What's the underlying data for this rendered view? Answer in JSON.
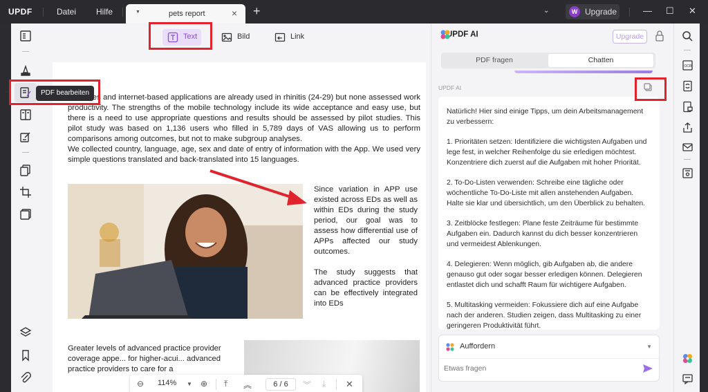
{
  "app": {
    "logo": "UPDF"
  },
  "menu": {
    "file": "Datei",
    "help": "Hilfe"
  },
  "tab": {
    "title": "pets report",
    "close": "×",
    "add": "+"
  },
  "account": {
    "avatar_letter": "W",
    "upgrade": "Upgrade"
  },
  "window_controls": {
    "minimize": "—",
    "maximize": "☐",
    "close": "✕"
  },
  "edit_toolbar": {
    "text": "Text",
    "image": "Bild",
    "link": "Link"
  },
  "tooltip": {
    "label": "PDF bearbeiten"
  },
  "document": {
    "para1": "...devices and internet-based applications are already used in rhinitis (24-29) but none assessed work productivity. The strengths of the mobile technology include its wide acceptance and easy use, but there is a need to use appropriate questions and results should be assessed by pilot studies. This pilot study was based on 1,136 users who filled in 5,789 days of VAS allowing us to perform comparisons among outcomes, but not to make subgroup analyses.",
    "para2": "We collected country, language, age, sex and date of entry of information with the App. We used very simple questions translated and back-translated into 15 languages.",
    "para3": "Since variation in APP use existed across EDs as well as within EDs during the study period, our goal was to assess how differential use of APPs affected our study outcomes.",
    "para4": "The study suggests that advanced practice providers can be effectively integrated into EDs",
    "para5": "Greater levels of advanced practice provider coverage appe... for higher-acui... advanced practice providers to care for a"
  },
  "page_nav": {
    "zoom": "114%",
    "current_page": "6",
    "total_pages": "6"
  },
  "ai": {
    "title": "UPDF AI",
    "upgrade": "Upgrade",
    "tab_ask_pdf": "PDF fragen",
    "tab_chat": "Chatten",
    "sender_label": "UPDF AI",
    "response": [
      "Natürlich! Hier sind einige Tipps, um dein Arbeitsmanagement zu verbessern:",
      "1. Prioritäten setzen: Identifiziere die wichtigsten Aufgaben und lege fest, in welcher Reihenfolge du sie erledigen möchtest. Konzentriere dich zuerst auf die Aufgaben mit hoher Priorität.",
      "2. To-Do-Listen verwenden: Schreibe eine tägliche oder wöchentliche To-Do-Liste mit allen anstehenden Aufgaben. Halte sie klar und übersichtlich, um den Überblick zu behalten.",
      "3. Zeitblöcke festlegen: Plane feste Zeiträume für bestimmte Aufgaben ein. Dadurch kannst du dich besser konzentrieren und vermeidest Ablenkungen.",
      "4. Delegieren: Wenn möglich, gib Aufgaben ab, die andere genauso gut oder sogar besser erledigen können. Delegieren entlastet dich und schafft Raum für wichtigere Aufgaben.",
      "5. Multitasking vermeiden: Fokussiere dich auf eine Aufgabe nach der anderen. Studien zeigen, dass Multitasking zu einer geringeren Produktivität führt."
    ],
    "prompt_label": "Auffordern",
    "input_placeholder": "Etwas fragen"
  },
  "colors": {
    "accent": "#8a4fd6",
    "annotation_red": "#e0232c",
    "titlebar": "#2a2a2f"
  }
}
